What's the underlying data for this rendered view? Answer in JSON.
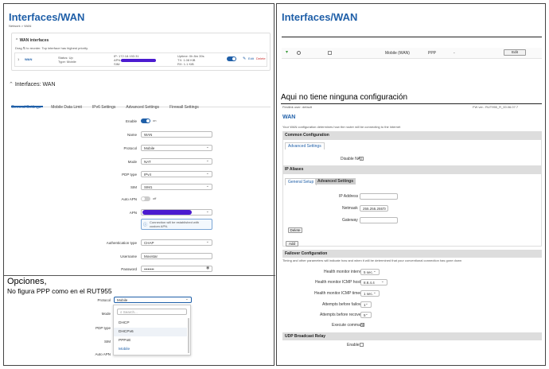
{
  "left": {
    "title": "Interfaces/WAN",
    "breadcrumb": "Network > WAN",
    "wan_section_title": "WAN interfaces",
    "wan_section_hint": "Drag ⇅ to reorder. Top interface has highest priority.",
    "wan_row": {
      "index": "1",
      "name": "WAN",
      "status_label": "Status: Up",
      "type_label": "Type: Mobile",
      "ip_label": "IP: 172.18.153.31",
      "apn_label": "APN:",
      "sim_label": "SIM:",
      "uptime_label": "Uptime: 0h 8m 39s",
      "tx_label": "TX: 1.08 KiB",
      "rx_label": "RX: 1.1 KiB",
      "edit_label": "Edit",
      "delete_label": "Delete"
    },
    "iface_title": "Interfaces: WAN",
    "tabs": [
      "General Settings",
      "Mobile Data Limit",
      "IPv6 Settings",
      "Advanced Settings",
      "Firewall Settings"
    ],
    "form": {
      "enable_label": "Enable",
      "enable_state": "on",
      "name_label": "Name",
      "name_value": "WAN",
      "protocol_label": "Protocol",
      "protocol_value": "Mobile",
      "mode_label": "Mode",
      "mode_value": "NAT",
      "pdp_label": "PDP type",
      "pdp_value": "IPv4",
      "sim_label": "SIM",
      "sim_value": "SIM1",
      "autoapn_label": "Auto APN",
      "autoapn_state": "off",
      "apn_label": "APN",
      "apn_info": "Connection will be established with custom APN.",
      "auth_label": "Authentication type",
      "auth_value": "CHAP",
      "user_label": "Username",
      "user_value": "Movistar",
      "pass_label": "Password",
      "pass_value": "••••••••"
    },
    "annotation": {
      "line1": "Opciones,",
      "line2": "No figura PPP como en el RUT955"
    },
    "dropdown": {
      "protocol_label": "Protocol",
      "protocol_value": "Mobile",
      "mode_label": "Mode",
      "pdp_label": "PDP type",
      "sim_label": "SIM",
      "autoapn_label": "Auto APN",
      "search_placeholder": "Search...",
      "options": [
        "DHCP",
        "DHCPv6",
        "PPPoE",
        "Mobile"
      ]
    }
  },
  "right": {
    "title": "Interfaces/WAN",
    "row": {
      "name": "Mobile (WAN)",
      "protocol": "PPP",
      "dash": "-",
      "edit_label": "Edit"
    },
    "annotation": "Aqui no tiene ninguna configuración",
    "topbar_left": "Firstlink user: default",
    "topbar_right": "FW ver.: RUT955_R_00.06.07.7",
    "wan_title": "WAN",
    "wan_desc": "Your WAN configuration determines how the router will be connecting to the internet",
    "common_head": "Common Configuration",
    "adv_tab": "Advanced Settings",
    "disable_nat": "Disable NAT",
    "ip_aliases_head": "IP Aliases",
    "tab_general": "General Setup",
    "tab_advanced": "Advanced Settings",
    "ip_label": "IP Address",
    "netmask_label": "Netmask",
    "netmask_value": "255.255.255.0",
    "gateway_label": "Gateway",
    "delete_label": "Delete",
    "add_label": "Add",
    "failover_head": "Failover Configuration",
    "failover_desc": "Timing and other parameters will indicate how and when it will be determined that your conventional connection has gone down",
    "health_interval_label": "Health monitor interval",
    "health_interval_value": "5 sec.",
    "icmp_host_label": "Health monitor ICMP host(s)",
    "icmp_host_value": "8.8.4.4",
    "icmp_timeout_label": "Health monitor ICMP timeout",
    "icmp_timeout_value": "1 sec.",
    "attempts_failover_label": "Attempts before failover",
    "attempts_failover_value": "1",
    "attempts_recovery_label": "Attempts before recovery",
    "attempts_recovery_value": "5",
    "execute_label": "Execute command",
    "udp_head": "UDP Broadcast Relay",
    "udp_enable_label": "Enable"
  },
  "colors": {
    "brand": "#1f5fa8",
    "toggle_on": "#1f5fa8",
    "highlight": "#4b1bd0",
    "info_border": "#7aa6d6"
  }
}
